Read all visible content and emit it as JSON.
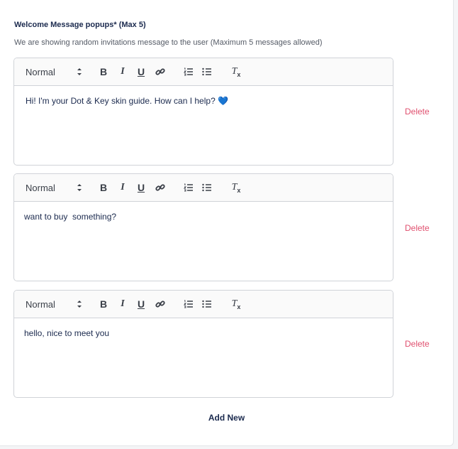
{
  "section": {
    "title": "Welcome Message popups* (Max 5)",
    "description": "We are showing random invitations message to the user (Maximum 5 messages allowed)"
  },
  "toolbar": {
    "format_value": "Normal",
    "bold_glyph": "B",
    "italic_glyph": "I",
    "underline_glyph": "U",
    "clear_glyph": "T",
    "clear_sub": "x"
  },
  "messages": [
    {
      "text": "Hi! I'm your Dot & Key skin guide. How can I help? ",
      "emoji": "💙"
    },
    {
      "text": "want to buy  something?"
    },
    {
      "text": "hello, nice to meet you"
    }
  ],
  "delete_label": "Delete",
  "add_new_label": "Add New",
  "colors": {
    "heading": "#1b2a4e",
    "delete": "#e0506f",
    "border": "#d0d3d8"
  }
}
